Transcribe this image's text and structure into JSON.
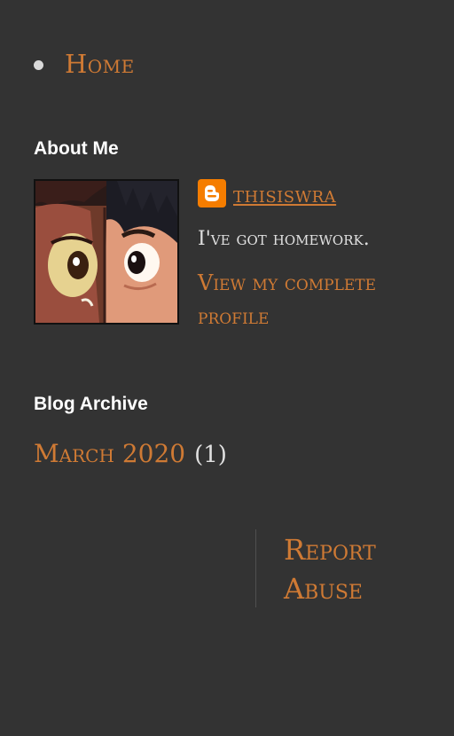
{
  "nav": {
    "items": [
      {
        "label": "Home"
      }
    ]
  },
  "about": {
    "title": "About Me",
    "profile_name": "thisiswra",
    "description": "I've got homework.",
    "view_profile_label": "View my complete profile",
    "icon": "blogger-icon"
  },
  "archive": {
    "title": "Blog Archive",
    "entries": [
      {
        "label": "March 2020",
        "count": "(1)"
      }
    ]
  },
  "footer": {
    "report_label": "Report Abuse"
  },
  "colors": {
    "background": "#333333",
    "accent": "#cf7a34",
    "text": "#e0e0e0",
    "heading": "#ffffff",
    "blogger": "#f57d00"
  }
}
